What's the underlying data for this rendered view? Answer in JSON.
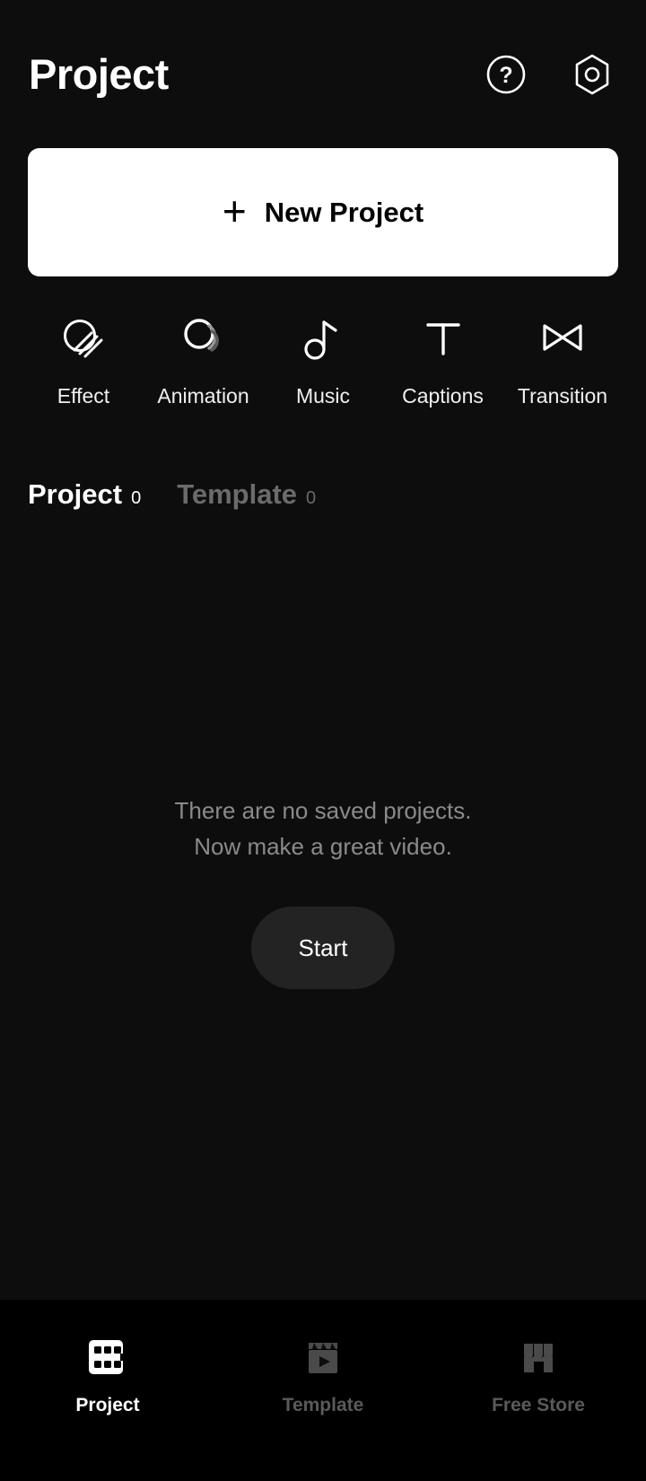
{
  "header": {
    "title": "Project",
    "help_icon": "help-circle-icon",
    "settings_icon": "settings-hexagon-icon"
  },
  "new_project": {
    "plus": "+",
    "label": "New Project"
  },
  "tools": [
    {
      "label": "Effect",
      "icon": "effect-icon"
    },
    {
      "label": "Animation",
      "icon": "animation-icon"
    },
    {
      "label": "Music",
      "icon": "music-note-icon"
    },
    {
      "label": "Captions",
      "icon": "text-t-icon"
    },
    {
      "label": "Transition",
      "icon": "transition-bowtie-icon"
    }
  ],
  "tabs": [
    {
      "label": "Project",
      "count": "0",
      "active": true
    },
    {
      "label": "Template",
      "count": "0",
      "active": false
    }
  ],
  "empty_state": {
    "line1": "There are no saved projects.",
    "line2": "Now make a great video.",
    "start_label": "Start"
  },
  "bottom_nav": [
    {
      "label": "Project",
      "icon": "filmstrip-icon",
      "active": true
    },
    {
      "label": "Template",
      "icon": "clapperboard-icon",
      "active": false
    },
    {
      "label": "Free Store",
      "icon": "storefront-icon",
      "active": false
    }
  ],
  "colors": {
    "background": "#0d0d0d",
    "nav_background": "#000000",
    "accent_card": "#ffffff",
    "muted_text": "#8a8a8a",
    "inactive": "#5a5a5a",
    "start_button": "#232323"
  }
}
